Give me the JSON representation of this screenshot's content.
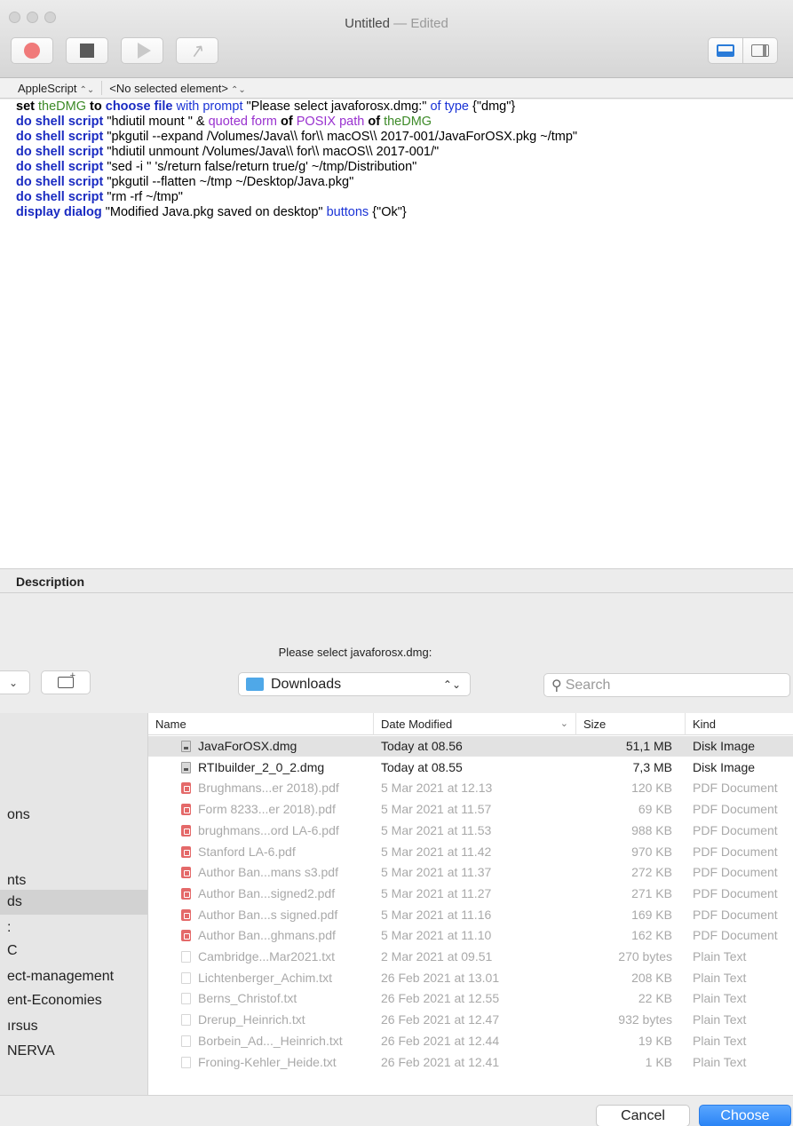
{
  "window": {
    "title": "Untitled",
    "title_suffix": " — Edited"
  },
  "toolbar": {
    "buttons": [
      "record",
      "stop",
      "run",
      "compile"
    ],
    "view_buttons": [
      "show-log-pane",
      "show-bundle-pane"
    ]
  },
  "navbar": {
    "language": "AppleScript",
    "element": "<No selected element>"
  },
  "script": {
    "lines": [
      [
        {
          "t": "set",
          "s": "kw"
        },
        {
          "t": " "
        },
        {
          "t": "theDMG",
          "s": "var"
        },
        {
          "t": " "
        },
        {
          "t": "to",
          "s": "kw"
        },
        {
          "t": " "
        },
        {
          "t": "choose file",
          "s": "cmd"
        },
        {
          "t": " "
        },
        {
          "t": "with prompt",
          "s": "prm"
        },
        {
          "t": " \"Please select javaforosx.dmg:\" "
        },
        {
          "t": "of type",
          "s": "prm"
        },
        {
          "t": " {\"dmg\"}"
        }
      ],
      [
        {
          "t": "do shell script",
          "s": "cmd"
        },
        {
          "t": " \"hdiutil mount \" & "
        },
        {
          "t": "quoted form",
          "s": "ptype"
        },
        {
          "t": " "
        },
        {
          "t": "of",
          "s": "kw"
        },
        {
          "t": " "
        },
        {
          "t": "POSIX path",
          "s": "ptype"
        },
        {
          "t": " "
        },
        {
          "t": "of",
          "s": "kw"
        },
        {
          "t": " "
        },
        {
          "t": "theDMG",
          "s": "var"
        }
      ],
      [
        {
          "t": "do shell script",
          "s": "cmd"
        },
        {
          "t": " \"pkgutil --expand /Volumes/Java\\\\ for\\\\ macOS\\\\ 2017-001/JavaForOSX.pkg ~/tmp\""
        }
      ],
      [
        {
          "t": "do shell script",
          "s": "cmd"
        },
        {
          "t": " \"hdiutil unmount /Volumes/Java\\\\ for\\\\ macOS\\\\ 2017-001/\""
        }
      ],
      [
        {
          "t": "do shell script",
          "s": "cmd"
        },
        {
          "t": " \"sed -i '' 's/return false/return true/g' ~/tmp/Distribution\""
        }
      ],
      [
        {
          "t": "do shell script",
          "s": "cmd"
        },
        {
          "t": " \"pkgutil --flatten ~/tmp ~/Desktop/Java.pkg\""
        }
      ],
      [
        {
          "t": "do shell script",
          "s": "cmd"
        },
        {
          "t": " \"rm -rf ~/tmp\""
        }
      ],
      [
        {
          "t": "display dialog",
          "s": "cmd"
        },
        {
          "t": " \"Modified Java.pkg saved on desktop\" "
        },
        {
          "t": "buttons",
          "s": "prm"
        },
        {
          "t": " {\"Ok\"}"
        }
      ]
    ]
  },
  "description": {
    "label": "Description"
  },
  "sheet": {
    "prompt": "Please select javaforosx.dmg:",
    "view_popup_chevron": "⌄",
    "location": "Downloads",
    "search_placeholder": "Search",
    "sidebar": [
      {
        "label": "ons",
        "selected": false
      },
      {
        "label": "nts",
        "selected": false
      },
      {
        "label": "ds",
        "selected": true
      },
      {
        "label": ":",
        "selected": false
      },
      {
        "label": "C",
        "selected": false
      },
      {
        "label": "ect-management",
        "selected": false
      },
      {
        "label": "ent-Economies",
        "selected": false
      },
      {
        "label": "ırsus",
        "selected": false
      },
      {
        "label": "NERVA",
        "selected": false
      }
    ],
    "columns": {
      "name": "Name",
      "date": "Date Modified",
      "size": "Size",
      "kind": "Kind"
    },
    "files": [
      {
        "name": "JavaForOSX.dmg",
        "date": "Today at 08.56",
        "size": "51,1 MB",
        "kind": "Disk Image",
        "type": "dmg",
        "enabled": true,
        "selected": true
      },
      {
        "name": "RTIbuilder_2_0_2.dmg",
        "date": "Today at 08.55",
        "size": "7,3 MB",
        "kind": "Disk Image",
        "type": "dmg",
        "enabled": true,
        "selected": false
      },
      {
        "name": "Brughmans...er 2018).pdf",
        "date": "5 Mar 2021 at 12.13",
        "size": "120 KB",
        "kind": "PDF Document",
        "type": "pdf",
        "enabled": false,
        "selected": false
      },
      {
        "name": "Form 8233...er 2018).pdf",
        "date": "5 Mar 2021 at 11.57",
        "size": "69 KB",
        "kind": "PDF Document",
        "type": "pdf",
        "enabled": false,
        "selected": false
      },
      {
        "name": "brughmans...ord LA-6.pdf",
        "date": "5 Mar 2021 at 11.53",
        "size": "988 KB",
        "kind": "PDF Document",
        "type": "pdf",
        "enabled": false,
        "selected": false
      },
      {
        "name": "Stanford LA-6.pdf",
        "date": "5 Mar 2021 at 11.42",
        "size": "970 KB",
        "kind": "PDF Document",
        "type": "pdf",
        "enabled": false,
        "selected": false
      },
      {
        "name": "Author Ban...mans s3.pdf",
        "date": "5 Mar 2021 at 11.37",
        "size": "272 KB",
        "kind": "PDF Document",
        "type": "pdf",
        "enabled": false,
        "selected": false
      },
      {
        "name": "Author Ban...signed2.pdf",
        "date": "5 Mar 2021 at 11.27",
        "size": "271 KB",
        "kind": "PDF Document",
        "type": "pdf",
        "enabled": false,
        "selected": false
      },
      {
        "name": "Author Ban...s signed.pdf",
        "date": "5 Mar 2021 at 11.16",
        "size": "169 KB",
        "kind": "PDF Document",
        "type": "pdf",
        "enabled": false,
        "selected": false
      },
      {
        "name": "Author Ban...ghmans.pdf",
        "date": "5 Mar 2021 at 11.10",
        "size": "162 KB",
        "kind": "PDF Document",
        "type": "pdf",
        "enabled": false,
        "selected": false
      },
      {
        "name": "Cambridge...Mar2021.txt",
        "date": "2 Mar 2021 at 09.51",
        "size": "270 bytes",
        "kind": "Plain Text",
        "type": "txt",
        "enabled": false,
        "selected": false
      },
      {
        "name": "Lichtenberger_Achim.txt",
        "date": "26 Feb 2021 at 13.01",
        "size": "208 KB",
        "kind": "Plain Text",
        "type": "txt",
        "enabled": false,
        "selected": false
      },
      {
        "name": "Berns_Christof.txt",
        "date": "26 Feb 2021 at 12.55",
        "size": "22 KB",
        "kind": "Plain Text",
        "type": "txt",
        "enabled": false,
        "selected": false
      },
      {
        "name": "Drerup_Heinrich.txt",
        "date": "26 Feb 2021 at 12.47",
        "size": "932 bytes",
        "kind": "Plain Text",
        "type": "txt",
        "enabled": false,
        "selected": false
      },
      {
        "name": "Borbein_Ad..._Heinrich.txt",
        "date": "26 Feb 2021 at 12.44",
        "size": "19 KB",
        "kind": "Plain Text",
        "type": "txt",
        "enabled": false,
        "selected": false
      },
      {
        "name": "Froning-Kehler_Heide.txt",
        "date": "26 Feb 2021 at 12.41",
        "size": "1 KB",
        "kind": "Plain Text",
        "type": "txt",
        "enabled": false,
        "selected": false
      }
    ],
    "cancel_label": "Cancel",
    "choose_label": "Choose"
  },
  "colors": {
    "keyword": "#000000",
    "command": "#1a2bc2",
    "variable": "#3d8a28",
    "parameter": "#1a33d6",
    "property": "#9931cf",
    "accent": "#2a84f5"
  }
}
